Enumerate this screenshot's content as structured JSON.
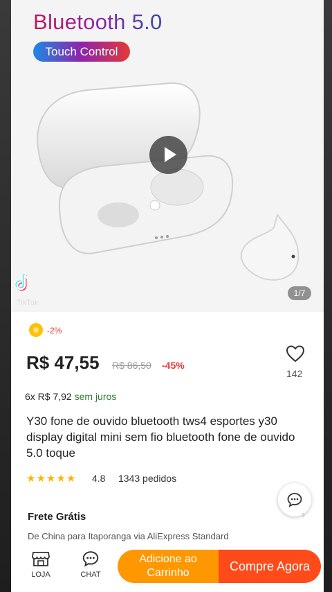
{
  "hero": {
    "title": "Bluetooth 5.0",
    "badge": "Touch Control",
    "image_counter": "1/7"
  },
  "tiktok": {
    "logo_text": "TikTok"
  },
  "promo": {
    "coin_label": "-2%"
  },
  "price": {
    "current": "R$ 47,55",
    "original": "R$ 86,50",
    "discount": "-45%"
  },
  "wishlist": {
    "count": "142"
  },
  "installments": {
    "text": "6x R$ 7,92",
    "label": "sem juros"
  },
  "product": {
    "title": "Y30 fone de ouvido bluetooth tws4 esportes y30 display digital mini sem fio bluetooth fone de ouvido 5.0 toque",
    "rating": "4.8",
    "orders": "1343 pedidos",
    "stars_count": 5
  },
  "shipping": {
    "title": "Frete Grátis",
    "detail": "De China para Itaporanga via AliExpress Standard"
  },
  "bottom_bar": {
    "store_label": "LOJA",
    "chat_label": "CHAT",
    "cart_label": "Adicione ao Carrinho",
    "buy_label": "Compre Agora"
  },
  "colors": {
    "buy": "#ff4a1a",
    "cart": "#ff9800",
    "discount": "#e53935"
  }
}
